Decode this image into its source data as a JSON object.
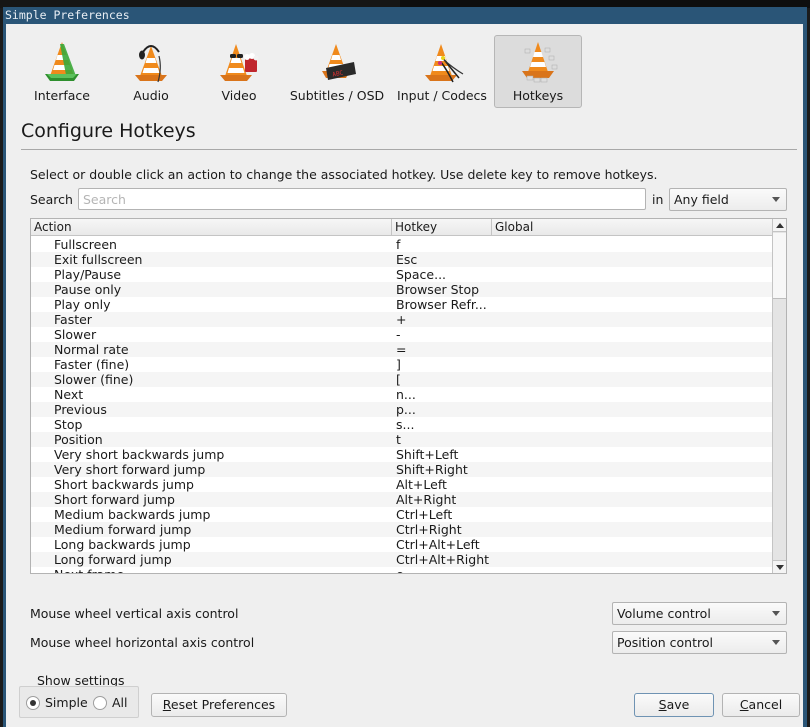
{
  "window": {
    "title": "Simple Preferences"
  },
  "categories": [
    {
      "label": "Interface",
      "icon": "vlc-cone-interface-icon",
      "active": false
    },
    {
      "label": "Audio",
      "icon": "vlc-cone-audio-icon",
      "active": false
    },
    {
      "label": "Video",
      "icon": "vlc-cone-video-icon",
      "active": false
    },
    {
      "label": "Subtitles / OSD",
      "icon": "vlc-cone-subtitles-icon",
      "active": false
    },
    {
      "label": "Input / Codecs",
      "icon": "vlc-cone-input-icon",
      "active": false
    },
    {
      "label": "Hotkeys",
      "icon": "vlc-cone-hotkeys-icon",
      "active": true
    }
  ],
  "section": {
    "title": "Configure Hotkeys",
    "hint": "Select or double click an action to change the associated hotkey. Use delete key to remove hotkeys."
  },
  "search": {
    "label": "Search",
    "value": "",
    "placeholder": "Search",
    "in_label": "in",
    "field_selected": "Any field"
  },
  "table": {
    "columns": [
      "Action",
      "Hotkey",
      "Global"
    ],
    "rows": [
      {
        "action": "Fullscreen",
        "hotkey": "f",
        "global": ""
      },
      {
        "action": "Exit fullscreen",
        "hotkey": "Esc",
        "global": ""
      },
      {
        "action": "Play/Pause",
        "hotkey": "Space...",
        "global": ""
      },
      {
        "action": "Pause only",
        "hotkey": "Browser Stop",
        "global": ""
      },
      {
        "action": "Play only",
        "hotkey": "Browser Refr...",
        "global": ""
      },
      {
        "action": "Faster",
        "hotkey": "+",
        "global": ""
      },
      {
        "action": "Slower",
        "hotkey": "-",
        "global": ""
      },
      {
        "action": "Normal rate",
        "hotkey": "=",
        "global": ""
      },
      {
        "action": "Faster (fine)",
        "hotkey": "]",
        "global": ""
      },
      {
        "action": "Slower (fine)",
        "hotkey": "[",
        "global": ""
      },
      {
        "action": "Next",
        "hotkey": "n...",
        "global": ""
      },
      {
        "action": "Previous",
        "hotkey": "p...",
        "global": ""
      },
      {
        "action": "Stop",
        "hotkey": "s...",
        "global": ""
      },
      {
        "action": "Position",
        "hotkey": "t",
        "global": ""
      },
      {
        "action": "Very short backwards jump",
        "hotkey": "Shift+Left",
        "global": ""
      },
      {
        "action": "Very short forward jump",
        "hotkey": "Shift+Right",
        "global": ""
      },
      {
        "action": "Short backwards jump",
        "hotkey": "Alt+Left",
        "global": ""
      },
      {
        "action": "Short forward jump",
        "hotkey": "Alt+Right",
        "global": ""
      },
      {
        "action": "Medium backwards jump",
        "hotkey": "Ctrl+Left",
        "global": ""
      },
      {
        "action": "Medium forward jump",
        "hotkey": "Ctrl+Right",
        "global": ""
      },
      {
        "action": "Long backwards jump",
        "hotkey": "Ctrl+Alt+Left",
        "global": ""
      },
      {
        "action": "Long forward jump",
        "hotkey": "Ctrl+Alt+Right",
        "global": ""
      },
      {
        "action": "Next frame",
        "hotkey": "e...",
        "global": ""
      }
    ]
  },
  "mouse_wheel": {
    "vertical_label": "Mouse wheel vertical axis control",
    "vertical_value": "Volume control",
    "horizontal_label": "Mouse wheel horizontal axis control",
    "horizontal_value": "Position control"
  },
  "show_settings": {
    "label": "Show settings",
    "options": [
      {
        "label": "Simple",
        "checked": true
      },
      {
        "label": "All",
        "checked": false
      }
    ]
  },
  "buttons": {
    "reset_mnemonic": "R",
    "reset_rest": "eset Preferences",
    "save_mnemonic": "S",
    "save_rest": "ave",
    "cancel_mnemonic": "C",
    "cancel_rest": "ancel"
  }
}
